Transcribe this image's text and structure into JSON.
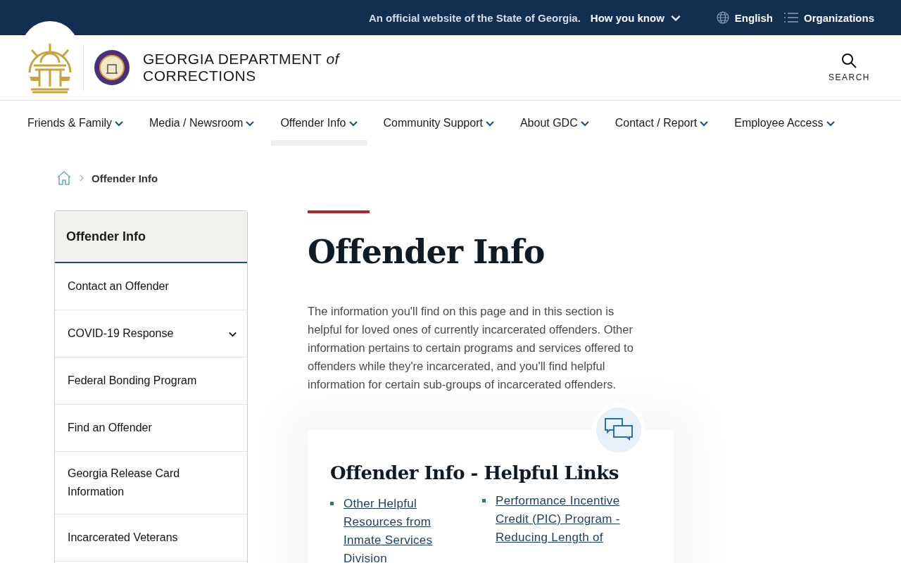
{
  "top_bar": {
    "notice": "An official website of the State of Georgia.",
    "how_you_know": "How you know",
    "language": "English",
    "organizations": "Organizations"
  },
  "header": {
    "title_line_1": "GEORGIA DEPARTMENT *of*",
    "title_line_2": "CORRECTIONS",
    "search_label": "SEARCH"
  },
  "nav": [
    {
      "label": "Friends & Family",
      "selected": false
    },
    {
      "label": "Media / Newsroom",
      "selected": false
    },
    {
      "label": "Offender Info",
      "selected": true
    },
    {
      "label": "Community Support",
      "selected": false
    },
    {
      "label": "About GDC",
      "selected": false
    },
    {
      "label": "Contact / Report",
      "selected": false
    },
    {
      "label": "Employee Access",
      "selected": false
    }
  ],
  "breadcrumb": {
    "current": "Offender Info"
  },
  "sidebar": {
    "title": "Offender Info",
    "items": [
      {
        "label": "Contact an Offender",
        "expandable": false
      },
      {
        "label": "COVID-19 Response",
        "expandable": true
      },
      {
        "label": "Federal Bonding Program",
        "expandable": false
      },
      {
        "label": "Find an Offender",
        "expandable": false
      },
      {
        "label": "Georgia Release Card Information",
        "expandable": false
      },
      {
        "label": "Incarcerated Veterans",
        "expandable": false
      }
    ]
  },
  "main": {
    "title": "Offender Info",
    "intro": "The information you'll find on this page and in this section is helpful for loved ones of currently incarcerated offenders. Other information pertains to certain programs and services offered to offenders while they're incarcerated, and you'll find helpful information for certain sub-groups of incarcerated offenders.",
    "card": {
      "title": "Offender Info - Helpful Links",
      "links": [
        "Other Helpful Resources from Inmate Services Division",
        "Performance Incentive Credit (PIC) Program - Reducing Length of"
      ]
    }
  }
}
